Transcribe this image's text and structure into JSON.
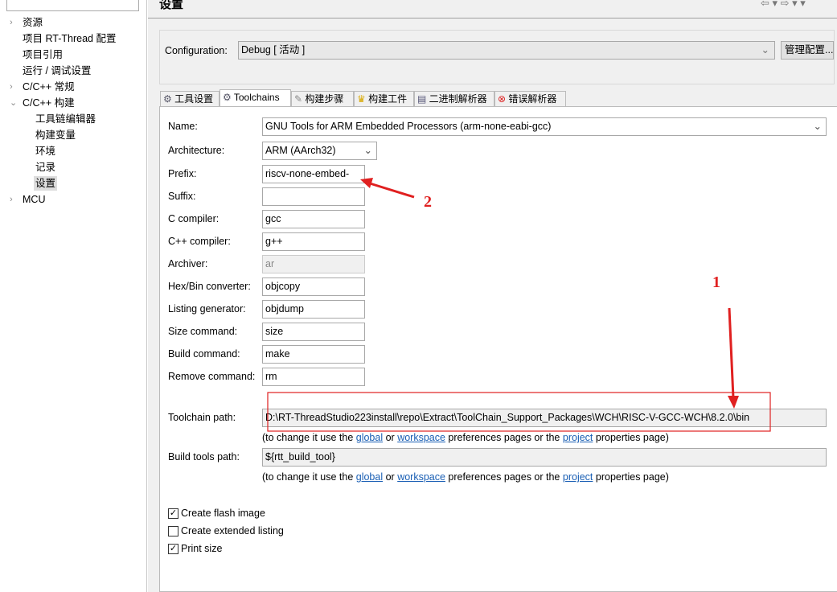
{
  "sidebar": {
    "items": [
      {
        "label": "资源",
        "arrow": "›"
      },
      {
        "label": "项目 RT-Thread 配置"
      },
      {
        "label": "项目引用"
      },
      {
        "label": "运行 / 调试设置"
      },
      {
        "label": "C/C++ 常规",
        "arrow": "›"
      },
      {
        "label": "C/C++ 构建",
        "arrow": "⌄"
      },
      {
        "label": "工具链编辑器"
      },
      {
        "label": "构建变量"
      },
      {
        "label": "环境"
      },
      {
        "label": "记录"
      },
      {
        "label": "设置",
        "selected": true
      },
      {
        "label": "MCU",
        "arrow": "›"
      }
    ]
  },
  "header": {
    "title": "设置"
  },
  "config": {
    "label": "Configuration:",
    "value": "Debug  [ 活动 ]",
    "manage_button": "管理配置..."
  },
  "tabs": [
    {
      "label": "工具设置",
      "icon": "tool-icon"
    },
    {
      "label": "Toolchains",
      "icon": "tool-icon",
      "active": true
    },
    {
      "label": "构建步骤",
      "icon": "wand-icon"
    },
    {
      "label": "构建工件",
      "icon": "trophy-icon"
    },
    {
      "label": "二进制解析器",
      "icon": "binary-file-icon"
    },
    {
      "label": "错误解析器",
      "icon": "error-icon"
    }
  ],
  "form": {
    "name": {
      "label": "Name:",
      "value": "GNU Tools for ARM Embedded Processors (arm-none-eabi-gcc)"
    },
    "architecture": {
      "label": "Architecture:",
      "value": "ARM (AArch32)"
    },
    "prefix": {
      "label": "Prefix:",
      "value": "riscv-none-embed-"
    },
    "suffix": {
      "label": "Suffix:",
      "value": ""
    },
    "c_compiler": {
      "label": "C compiler:",
      "value": "gcc"
    },
    "cpp_compiler": {
      "label": "C++ compiler:",
      "value": "g++"
    },
    "archiver": {
      "label": "Archiver:",
      "value": "ar"
    },
    "hexbin": {
      "label": "Hex/Bin converter:",
      "value": "objcopy"
    },
    "listing": {
      "label": "Listing generator:",
      "value": "objdump"
    },
    "size": {
      "label": "Size command:",
      "value": "size"
    },
    "build": {
      "label": "Build command:",
      "value": "make"
    },
    "remove": {
      "label": "Remove command:",
      "value": "rm"
    },
    "toolchain_path": {
      "label": "Toolchain path:",
      "value": "D:\\RT-ThreadStudio223install\\repo\\Extract\\ToolChain_Support_Packages\\WCH\\RISC-V-GCC-WCH\\8.2.0\\bin"
    },
    "build_tools_path": {
      "label": "Build tools path:",
      "value": "${rtt_build_tool}"
    },
    "note": {
      "pre": "(to change it use the ",
      "global": "global",
      "or": " or ",
      "workspace": "workspace",
      "mid": " preferences pages or the ",
      "project": "project",
      "post": " properties page)"
    }
  },
  "checkboxes": [
    {
      "label": "Create flash image",
      "checked": true
    },
    {
      "label": "Create extended listing",
      "checked": false
    },
    {
      "label": "Print size",
      "checked": true
    }
  ],
  "annotations": {
    "one": "1",
    "two": "2",
    "color": "#e02020"
  }
}
